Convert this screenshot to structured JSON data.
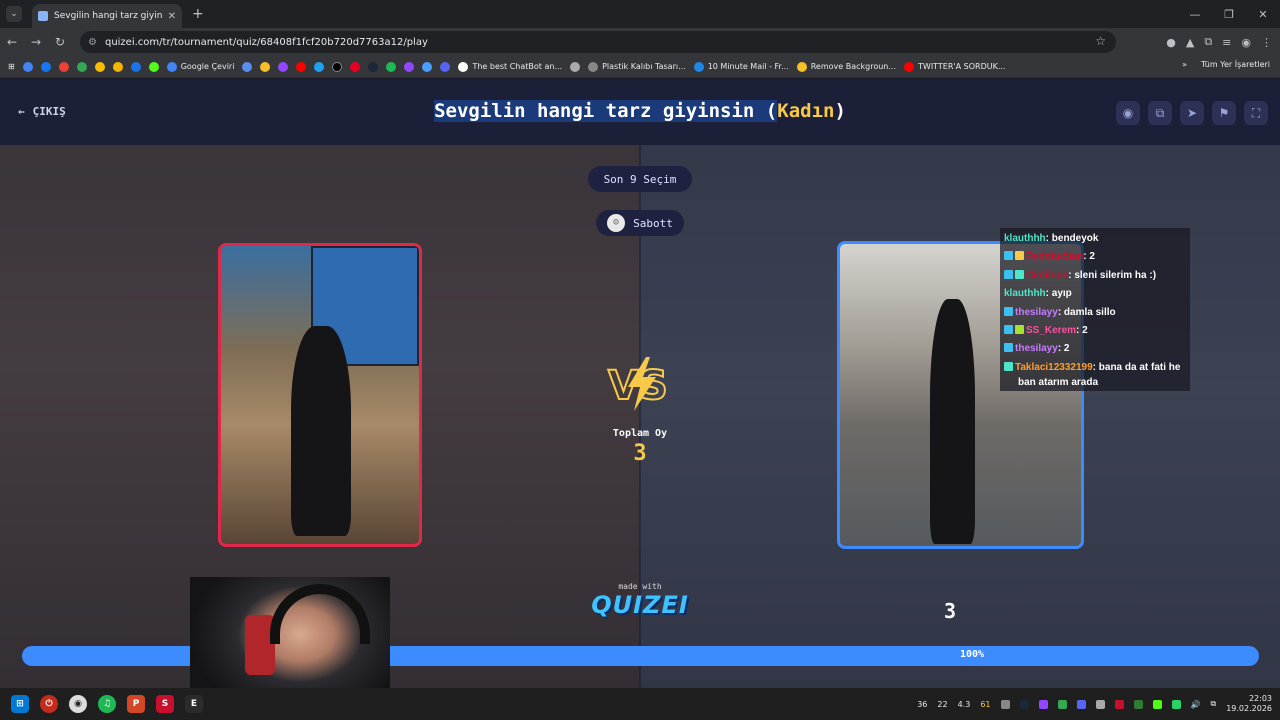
{
  "browser": {
    "tab_title": "Sevgilin hangi tarz giyinsin (Kad",
    "url": "quizei.com/tr/tournament/quiz/68408f1fcf20b720d7763a12/play",
    "bookmarks": [
      "Google Çeviri",
      "The best ChatBot an...",
      "Plastik Kalıbı Tasarı...",
      "10 Minute Mail - Fr...",
      "Remove Backgroun...",
      "TWITTER'A SORDUK..."
    ],
    "bookmarks_all": "Tüm Yer İşaretleri"
  },
  "page": {
    "back_label": "ÇIKIŞ",
    "title_main": "Sevgilin hangi tarz giyinsin (",
    "title_accent": "Kadın",
    "title_close": ")",
    "last_choice": "Son 9 Seçim",
    "user_name": "Sabott",
    "total_label": "Toplam Oy",
    "total_value": "3",
    "right_votes": "3",
    "progress_text": "100%",
    "progress_value": 100,
    "made_with": "made with",
    "logo": "QUIZEI"
  },
  "chat": [
    {
      "user": "klauthhh",
      "msg": ": bendeyok",
      "color": "#4ee6c8"
    },
    {
      "user": "Reddiuchan",
      "msg": ": 2",
      "color": "#c8102e"
    },
    {
      "user": "Cimilope",
      "msg": ": sleni silerim ha :)",
      "color": "#c8102e"
    },
    {
      "user": "klauthhh",
      "msg": ": ayıp",
      "color": "#4ee6c8"
    },
    {
      "user": "thesilayy",
      "msg": ": damla sillo",
      "color": "#c77dff"
    },
    {
      "user": "SS_Kerem",
      "msg": ": 2",
      "color": "#ff4fa3"
    },
    {
      "user": "thesilayy",
      "msg": ": 2",
      "color": "#c77dff"
    },
    {
      "user": "Taklaci12332199",
      "msg": ": bana da at fati he",
      "color": "#ff9f2e"
    },
    {
      "user": "",
      "msg": "ban atarım arada",
      "color": "#ffffff"
    }
  ],
  "taskbar": {
    "time": "22:03",
    "date": "19.02.2026",
    "stats": [
      "36",
      "22",
      "4.3",
      "61"
    ]
  }
}
